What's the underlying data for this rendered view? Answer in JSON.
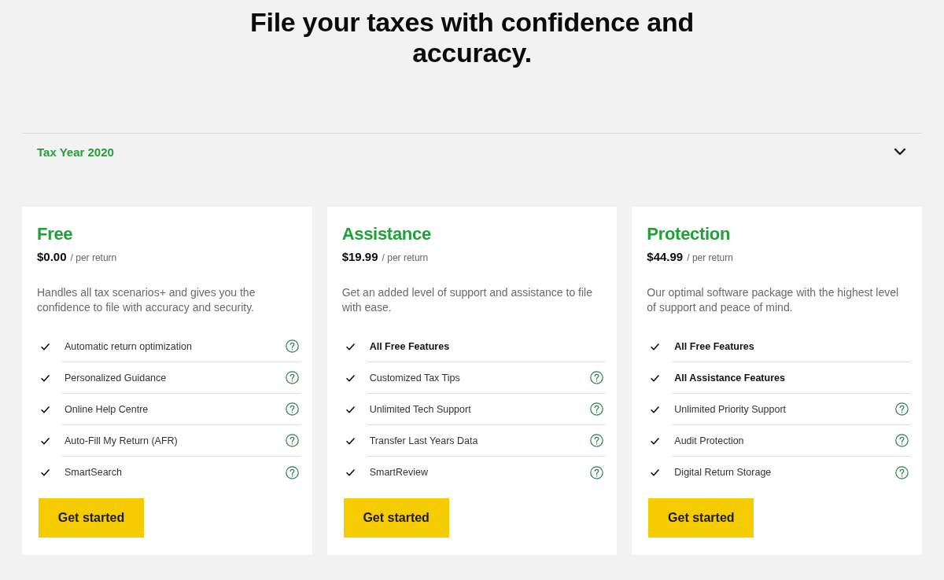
{
  "heading": "File your taxes with confidence and accuracy.",
  "tax_year": {
    "label": "Tax Year 2020",
    "expanded": false
  },
  "plans": [
    {
      "name": "Free",
      "price": "$0.00",
      "period": "/ per return",
      "description": "Handles all tax scenarios+ and gives you the confidence to file with accuracy and security.",
      "features": [
        {
          "kind": "feature",
          "label": "Automatic return optimization"
        },
        {
          "kind": "feature",
          "label": "Personalized Guidance"
        },
        {
          "kind": "feature",
          "label": "Online Help Centre"
        },
        {
          "kind": "feature",
          "label": "Auto-Fill My Return (AFR)"
        },
        {
          "kind": "feature",
          "label": "SmartSearch"
        }
      ],
      "button": "Get started"
    },
    {
      "name": "Assistance",
      "price": "$19.99",
      "period": "/ per return",
      "description": "Get an added level of support and assistance to file with ease.",
      "features": [
        {
          "kind": "bundle",
          "label": "All Free Features"
        },
        {
          "kind": "feature",
          "label": "Customized Tax Tips"
        },
        {
          "kind": "feature",
          "label": "Unlimited Tech Support"
        },
        {
          "kind": "feature",
          "label": "Transfer Last Years Data"
        },
        {
          "kind": "feature",
          "label": "SmartReview"
        }
      ],
      "button": "Get started"
    },
    {
      "name": "Protection",
      "price": "$44.99",
      "period": "/ per return",
      "description": "Our optimal software package with the highest level of support and peace of mind.",
      "features": [
        {
          "kind": "bundle",
          "label": "All Free Features"
        },
        {
          "kind": "bundle",
          "label": "All Assistance Features"
        },
        {
          "kind": "feature",
          "label": "Unlimited Priority Support"
        },
        {
          "kind": "feature",
          "label": "Audit Protection"
        },
        {
          "kind": "feature",
          "label": "Digital Return Storage"
        }
      ],
      "button": "Get started"
    }
  ]
}
